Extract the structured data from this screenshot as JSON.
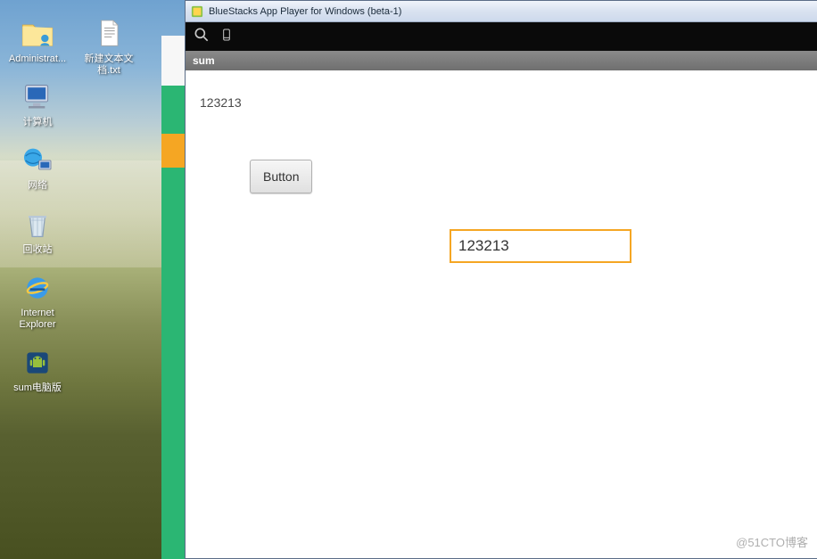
{
  "desktop": {
    "icons_col1": [
      {
        "name": "admin-folder",
        "label": "Administrat..."
      },
      {
        "name": "computer",
        "label": "计算机"
      },
      {
        "name": "network",
        "label": "网络"
      },
      {
        "name": "recycle-bin",
        "label": "回收站"
      },
      {
        "name": "internet-explorer",
        "label": "Internet Explorer"
      },
      {
        "name": "sum-app",
        "label": "sum电脑版"
      }
    ],
    "icon_col2": {
      "name": "text-file",
      "label": "新建文本文档.txt"
    }
  },
  "bluestacks": {
    "title": "BlueStacks App Player for Windows (beta-1)",
    "header": "sum",
    "text": "123213",
    "button_label": "Button",
    "input_value": "123213"
  },
  "watermark": "@51CTO博客"
}
